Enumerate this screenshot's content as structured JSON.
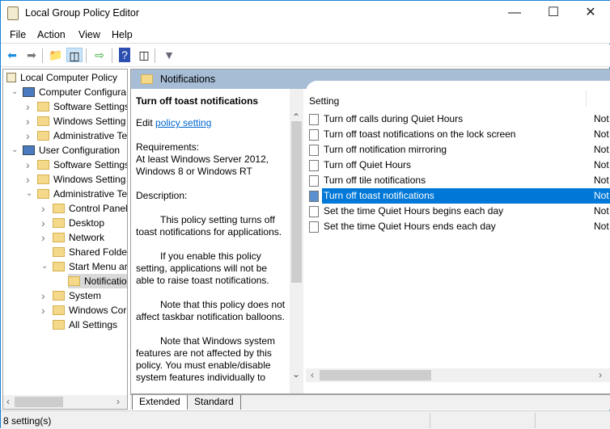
{
  "window": {
    "title": "Local Group Policy Editor",
    "controls": [
      "minimize",
      "maximize",
      "close"
    ]
  },
  "menu": [
    "File",
    "Action",
    "View",
    "Help"
  ],
  "toolbar": [
    "back-icon",
    "forward-icon",
    "up-folder-icon",
    "show-hide-tree-icon",
    "export-list-icon",
    "help-icon",
    "show-hide-action-pane-icon",
    "filter-icon"
  ],
  "tree": [
    {
      "label": "Local Computer Policy",
      "level": 0
    },
    {
      "label": "Computer Configura",
      "level": 1,
      "expanded": true
    },
    {
      "label": "Software Settings",
      "level": 2
    },
    {
      "label": "Windows Setting",
      "level": 2
    },
    {
      "label": "Administrative Te",
      "level": 2
    },
    {
      "label": "User Configuration",
      "level": 1,
      "expanded": true
    },
    {
      "label": "Software Settings",
      "level": 2
    },
    {
      "label": "Windows Setting",
      "level": 2
    },
    {
      "label": "Administrative Te",
      "level": 2,
      "expanded": true
    },
    {
      "label": "Control Panel",
      "level": 3
    },
    {
      "label": "Desktop",
      "level": 3
    },
    {
      "label": "Network",
      "level": 3
    },
    {
      "label": "Shared Folder",
      "level": 3
    },
    {
      "label": "Start Menu ar",
      "level": 3,
      "expanded": true
    },
    {
      "label": "Notificatio",
      "level": 4,
      "selected": true
    },
    {
      "label": "System",
      "level": 3
    },
    {
      "label": "Windows Cor",
      "level": 3
    },
    {
      "label": "All Settings",
      "level": 3
    }
  ],
  "header": {
    "title": "Notifications"
  },
  "description": {
    "title": "Turn off toast notifications",
    "edit_prefix": "Edit ",
    "edit_link": "policy setting ",
    "requirements_label": "Requirements:",
    "requirements": "At least Windows Server 2012, Windows 8 or Windows RT",
    "description_label": "Description:",
    "p1": "This policy setting turns off toast notifications for applications.",
    "p2": "If you enable this policy setting, applications will not be able to raise toast notifications.",
    "p3": "Note that this policy does not affect taskbar notification balloons.",
    "p4": "Note that Windows system features are not affected by this policy.  You must enable/disable system features individually to"
  },
  "list": {
    "column": "Setting",
    "rows": [
      {
        "setting": "Turn off calls during Quiet Hours",
        "state": "Not"
      },
      {
        "setting": "Turn off toast notifications on the lock screen",
        "state": "Not"
      },
      {
        "setting": "Turn off notification mirroring",
        "state": "Not"
      },
      {
        "setting": "Turn off Quiet Hours",
        "state": "Not"
      },
      {
        "setting": "Turn off tile notifications",
        "state": "Not"
      },
      {
        "setting": "Turn off toast notifications",
        "state": "Not",
        "selected": true
      },
      {
        "setting": "Set the time Quiet Hours begins each day",
        "state": "Not"
      },
      {
        "setting": "Set the time Quiet Hours ends each day",
        "state": "Not"
      }
    ]
  },
  "tabs": [
    "Extended",
    "Standard"
  ],
  "status": "8 setting(s)",
  "colors": {
    "selection": "#0078d7",
    "header": "#a7bdd6",
    "link": "#0066cc"
  }
}
